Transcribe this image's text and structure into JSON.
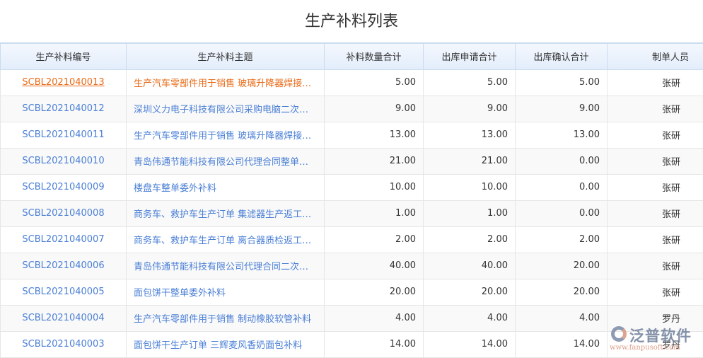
{
  "title": "生产补料列表",
  "columns": [
    "生产补料编号",
    "生产补料主题",
    "补料数量合计",
    "出库申请合计",
    "出库确认合计",
    "制单人员"
  ],
  "rows": [
    [
      "SCBL2021040013",
      "生产汽车零部件用于销售 玻璃升降器焊接补料",
      "5.00",
      "5.00",
      "5.00",
      "张研"
    ],
    [
      "SCBL2021040012",
      "深圳义力电子科技有限公司采购电脑二次补料",
      "9.00",
      "9.00",
      "9.00",
      "张研"
    ],
    [
      "SCBL2021040011",
      "生产汽车零部件用于销售 玻璃升降器焊接补料",
      "13.00",
      "13.00",
      "13.00",
      "张研"
    ],
    [
      "SCBL2021040010",
      "青岛伟通节能科技有限公司代理合同整单补料",
      "21.00",
      "21.00",
      "0.00",
      "张研"
    ],
    [
      "SCBL2021040009",
      "楼盘车整单委外补料",
      "10.00",
      "10.00",
      "0.00",
      "张研"
    ],
    [
      "SCBL2021040008",
      "商务车、救护车生产订单 集滤器生产返工补料",
      "1.00",
      "1.00",
      "0.00",
      "张研"
    ],
    [
      "SCBL2021040007",
      "商务车、救护车生产订单 离合器质检返工补料",
      "2.00",
      "2.00",
      "2.00",
      "张研"
    ],
    [
      "SCBL2021040006",
      "青岛伟通节能科技有限公司代理合同二次补料",
      "40.00",
      "40.00",
      "20.00",
      "张研"
    ],
    [
      "SCBL2021040005",
      "面包饼干整单委外补料",
      "20.00",
      "20.00",
      "20.00",
      "张研"
    ],
    [
      "SCBL2021040004",
      "生产汽车零部件用于销售 制动橡胶软管补料",
      "4.00",
      "4.00",
      "4.00",
      "罗丹"
    ],
    [
      "SCBL2021040003",
      "面包饼干生产订单 三辉麦风香奶面包补料",
      "14.00",
      "14.00",
      "14.00",
      "罗丹"
    ]
  ],
  "watermark": {
    "name": "泛普软件",
    "url": "www.fanpusoft.com"
  }
}
